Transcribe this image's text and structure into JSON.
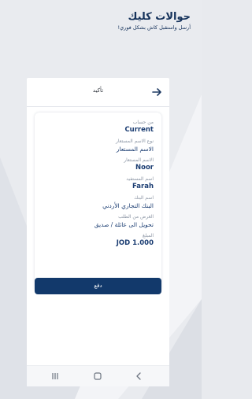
{
  "brand": {
    "title": "حوالات كليك",
    "subtitle": "أرسل واستقبل كاش بشكل فوري!"
  },
  "header": {
    "title": "تأكيد",
    "back_icon": "arrow-right-icon"
  },
  "fields": [
    {
      "label": "من حساب",
      "value": "Current"
    },
    {
      "label": "نوع الاسم المستعار",
      "value": "الاسم المستعار"
    },
    {
      "label": "الاسم المستعار",
      "value": "Noor"
    },
    {
      "label": "اسم المستفيد",
      "value": "Farah"
    },
    {
      "label": "اسم البنك",
      "value": "البنك التجاري الأردني"
    },
    {
      "label": "الغرض من الطلب",
      "value": "تحويل الى عائلة / صديق"
    },
    {
      "label": "المبلغ",
      "value": "1.000 JOD"
    }
  ],
  "actions": {
    "pay_label": "دفع"
  },
  "navbar": {
    "recents_icon": "recents-icon",
    "home_icon": "home-icon",
    "back_icon": "chevron-left-icon"
  }
}
